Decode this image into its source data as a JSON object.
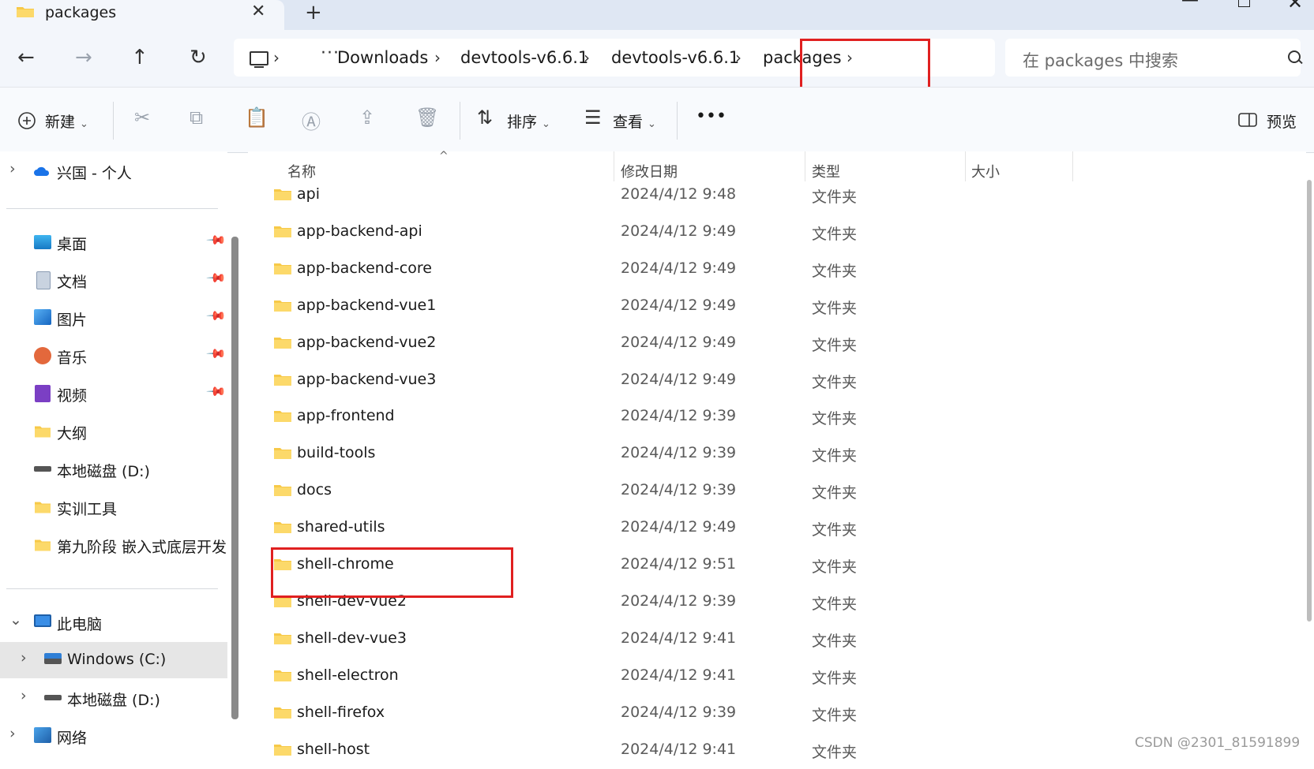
{
  "tab": {
    "title": "packages",
    "close_symbol": "✕",
    "new_symbol": "+"
  },
  "window_controls": {
    "minimize": "—",
    "close": "✕"
  },
  "nav_buttons": {
    "back": "←",
    "forward": "→",
    "up": "↑",
    "refresh": "↻"
  },
  "breadcrumb": {
    "more": "···",
    "separator": "›",
    "items": [
      "Downloads",
      "devtools-v6.6.1",
      "devtools-v6.6.1",
      "packages"
    ]
  },
  "search": {
    "placeholder": "在 packages 中搜索"
  },
  "toolbar": {
    "new_label": "新建",
    "sort_label": "排序",
    "view_label": "查看",
    "more_label": "•••",
    "preview_label": "预览",
    "chevron": "⌄"
  },
  "sidebar": {
    "items": [
      {
        "label": "兴国 - 个人",
        "icon": "cloud-icon"
      },
      {
        "label": "桌面",
        "icon": "desktop-icon",
        "pinned": true
      },
      {
        "label": "文档",
        "icon": "document-icon",
        "pinned": true
      },
      {
        "label": "图片",
        "icon": "pictures-icon",
        "pinned": true
      },
      {
        "label": "音乐",
        "icon": "music-icon",
        "pinned": true
      },
      {
        "label": "视频",
        "icon": "video-icon",
        "pinned": true
      },
      {
        "label": "大纲",
        "icon": "folder-icon"
      },
      {
        "label": "本地磁盘 (D:)",
        "icon": "drive-icon"
      },
      {
        "label": "实训工具",
        "icon": "folder-icon"
      },
      {
        "label": "第九阶段 嵌入式底层开发之",
        "icon": "folder-icon"
      },
      {
        "label": "此电脑",
        "icon": "computer-icon"
      },
      {
        "label": "Windows (C:)",
        "icon": "windows-drive-icon",
        "selected": true
      },
      {
        "label": "本地磁盘 (D:)",
        "icon": "drive-icon"
      },
      {
        "label": "网络",
        "icon": "network-icon"
      }
    ],
    "pin_symbol": "📌",
    "chevron_right": "›",
    "chevron_down": "⌄"
  },
  "columns": {
    "name": "名称",
    "date": "修改日期",
    "type": "类型",
    "size": "大小"
  },
  "files": [
    {
      "name": "api",
      "date": "2024/4/12 9:48",
      "type": "文件夹"
    },
    {
      "name": "app-backend-api",
      "date": "2024/4/12 9:49",
      "type": "文件夹"
    },
    {
      "name": "app-backend-core",
      "date": "2024/4/12 9:49",
      "type": "文件夹"
    },
    {
      "name": "app-backend-vue1",
      "date": "2024/4/12 9:49",
      "type": "文件夹"
    },
    {
      "name": "app-backend-vue2",
      "date": "2024/4/12 9:49",
      "type": "文件夹"
    },
    {
      "name": "app-backend-vue3",
      "date": "2024/4/12 9:49",
      "type": "文件夹"
    },
    {
      "name": "app-frontend",
      "date": "2024/4/12 9:39",
      "type": "文件夹"
    },
    {
      "name": "build-tools",
      "date": "2024/4/12 9:39",
      "type": "文件夹"
    },
    {
      "name": "docs",
      "date": "2024/4/12 9:39",
      "type": "文件夹"
    },
    {
      "name": "shared-utils",
      "date": "2024/4/12 9:49",
      "type": "文件夹"
    },
    {
      "name": "shell-chrome",
      "date": "2024/4/12 9:51",
      "type": "文件夹"
    },
    {
      "name": "shell-dev-vue2",
      "date": "2024/4/12 9:39",
      "type": "文件夹"
    },
    {
      "name": "shell-dev-vue3",
      "date": "2024/4/12 9:41",
      "type": "文件夹"
    },
    {
      "name": "shell-electron",
      "date": "2024/4/12 9:41",
      "type": "文件夹"
    },
    {
      "name": "shell-firefox",
      "date": "2024/4/12 9:39",
      "type": "文件夹"
    },
    {
      "name": "shell-host",
      "date": "2024/4/12 9:41",
      "type": "文件夹"
    }
  ],
  "watermark": "CSDN @2301_81591899",
  "colors": {
    "folder": "#f7c948",
    "highlight": "#e02020",
    "accent": "#0067c0"
  }
}
